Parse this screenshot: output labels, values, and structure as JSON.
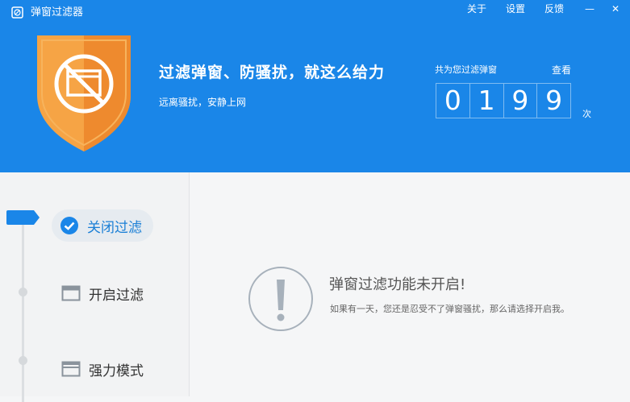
{
  "app": {
    "title": "弹窗过滤器"
  },
  "menu": {
    "about": "关于",
    "settings": "设置",
    "feedback": "反馈"
  },
  "window_controls": {
    "minimize": "—",
    "close": "✕"
  },
  "banner": {
    "headline": "过滤弹窗、防骚扰，就这么给力",
    "subline": "远离骚扰，安静上网"
  },
  "counter": {
    "label": "共为您过滤弹窗",
    "view_link": "查看",
    "digits": [
      "0",
      "1",
      "9",
      "9"
    ],
    "unit": "次"
  },
  "nav": {
    "items": [
      {
        "label": "关闭过滤",
        "icon": "check-circle-icon",
        "active": true
      },
      {
        "label": "开启过滤",
        "icon": "window-icon",
        "active": false
      },
      {
        "label": "强力模式",
        "icon": "window-stack-icon",
        "active": false
      }
    ]
  },
  "status": {
    "title": "弹窗过滤功能未开启!",
    "description": "如果有一天，您还是忍受不了弹窗骚扰，那么请选择开启我。",
    "icon": "exclamation-icon"
  },
  "colors": {
    "header_bg": "#1a86e8",
    "shield": "#f08a2c",
    "accent": "#1a86e8"
  }
}
